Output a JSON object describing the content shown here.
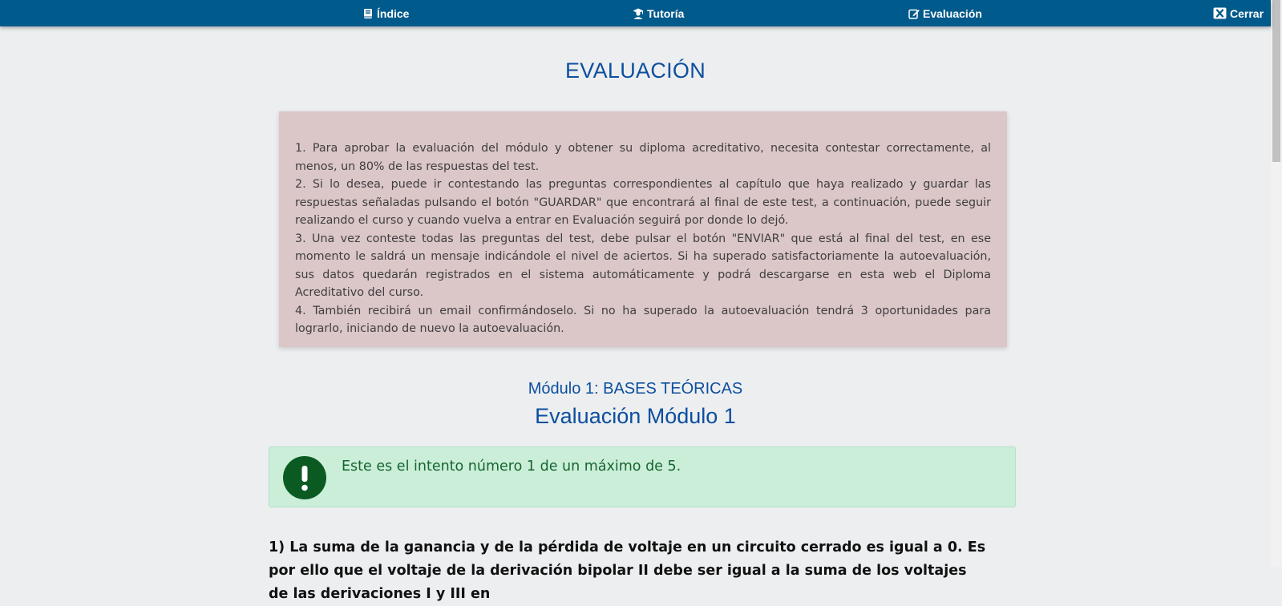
{
  "nav": {
    "indice": "Índice",
    "tutoria": "Tutoría",
    "evaluacion": "Evaluación",
    "cerrar": "Cerrar"
  },
  "page_title": "EVALUACIÓN",
  "instructions": [
    "1. Para aprobar la evaluación del módulo y obtener su diploma acreditativo, necesita contestar correctamente, al menos, un 80% de las respuestas del test.",
    "2. Si lo desea, puede ir contestando las preguntas correspondientes al capítulo que haya realizado y guardar las respuestas señaladas pulsando el botón \"GUARDAR\" que encontrará al final de este test, a continuación, puede seguir realizando el curso y cuando vuelva a entrar en Evaluación seguirá por donde lo dejó.",
    "3. Una vez conteste todas las preguntas del test, debe pulsar el botón \"ENVIAR\" que está al final del test, en ese momento le saldrá un mensaje indicándole el nivel de aciertos. Si ha superado satisfactoriamente la autoevaluación, sus datos quedarán registrados en el sistema automáticamente y podrá descargarse en esta web el Diploma Acreditativo del curso.",
    "4. También recibirá un email confirmándoselo. Si no ha superado la autoevaluación tendrá 3 oportunidades para lograrlo, iniciando de nuevo la autoevaluación."
  ],
  "module_subtitle": "Módulo 1: BASES TEÓRICAS",
  "module_title": "Evaluación Módulo 1",
  "alert_text": "Este es el intento número 1 de un máximo de 5.",
  "question_text": "1) La suma de la ganancia y de la pérdida de voltaje en un circuito cerrado es igual a 0. Es por ello que el voltaje de la derivación bipolar II debe ser igual a la suma de los voltajes de las derivaciones I y III en",
  "colors": {
    "topbar": "#005a8c",
    "title": "#0d4f9e",
    "instructions_bg": "#dbc6c8",
    "alert_bg": "#cbeed9",
    "alert_icon": "#0b5a22",
    "alert_text": "#15652e"
  },
  "icons": {
    "indice": "book-icon",
    "tutoria": "tutor-icon",
    "evaluacion": "edit-icon",
    "cerrar": "close-icon",
    "alert": "exclamation-icon"
  }
}
